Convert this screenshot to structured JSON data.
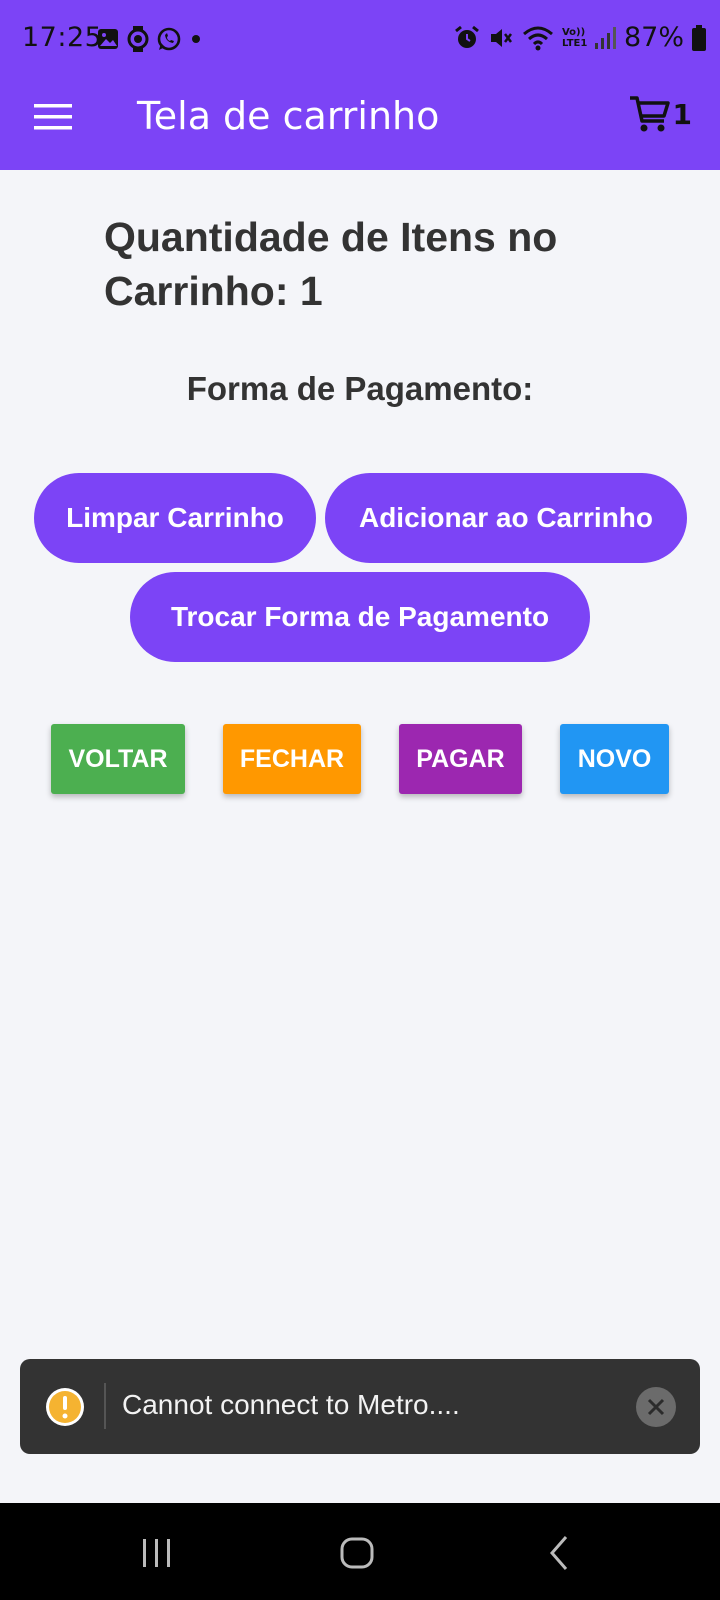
{
  "status_bar": {
    "time": "17:25",
    "battery": "87%",
    "left_icons": [
      "gallery-icon",
      "watch-icon",
      "whatsapp-icon",
      "dot-icon"
    ],
    "right_icons": [
      "alarm-icon",
      "mute-icon",
      "wifi-icon",
      "volte-icon",
      "signal-icon",
      "battery-icon"
    ],
    "volte_label": "Vo)) LTE1"
  },
  "app_bar": {
    "title": "Tela de carrinho",
    "cart_count": "1",
    "background": "#7c44f6"
  },
  "content": {
    "quantity_title": "Quantidade de Itens no Carrinho: 1",
    "payment_label": "Forma de Pagamento:",
    "pill_buttons": {
      "clear": "Limpar Carrinho",
      "add": "Adicionar ao Carrinho",
      "swap_payment": "Trocar Forma de Pagamento"
    },
    "action_buttons": {
      "voltar": "VOLTAR",
      "fechar": "FECHAR",
      "pagar": "PAGAR",
      "novo": "NOVO"
    },
    "colors": {
      "accent": "#7c44f6",
      "voltar": "#4caf50",
      "fechar": "#ff9800",
      "pagar": "#9c27b0",
      "novo": "#2196f3"
    }
  },
  "toast": {
    "message": "Cannot connect to Metro....",
    "icon": "warning-icon",
    "close_icon": "close-icon"
  },
  "nav_bar": {
    "buttons": [
      "recent-apps-icon",
      "home-icon",
      "back-icon"
    ]
  }
}
